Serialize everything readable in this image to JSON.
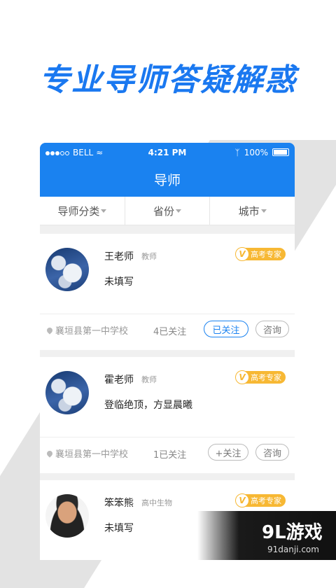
{
  "headline": "专业导师答疑解惑",
  "status_bar": {
    "carrier": "BELL",
    "time": "4:21 PM",
    "battery": "100%"
  },
  "nav": {
    "title": "导师"
  },
  "filters": [
    "导师分类",
    "省份",
    "城市"
  ],
  "mentors": [
    {
      "name": "王老师",
      "title": "教师",
      "badge": "高考专家",
      "intro": "未填写",
      "school": "襄垣县第一中学校",
      "followers": "4已关注",
      "follow_button": "已关注",
      "ask_button": "咨询"
    },
    {
      "name": "霍老师",
      "title": "教师",
      "badge": "高考专家",
      "intro": "登临绝顶，方显晨曦",
      "school": "襄垣县第一中学校",
      "followers": "1已关注",
      "follow_button": "+关注",
      "ask_button": "咨询"
    },
    {
      "name": "笨笨熊",
      "title": "高中生物",
      "badge": "高考专家",
      "intro": "未填写"
    }
  ],
  "watermark": {
    "brand": "9L游戏",
    "url": "91danji.com"
  },
  "colors": {
    "accent": "#1a82f0",
    "badge": "#f7b834"
  }
}
